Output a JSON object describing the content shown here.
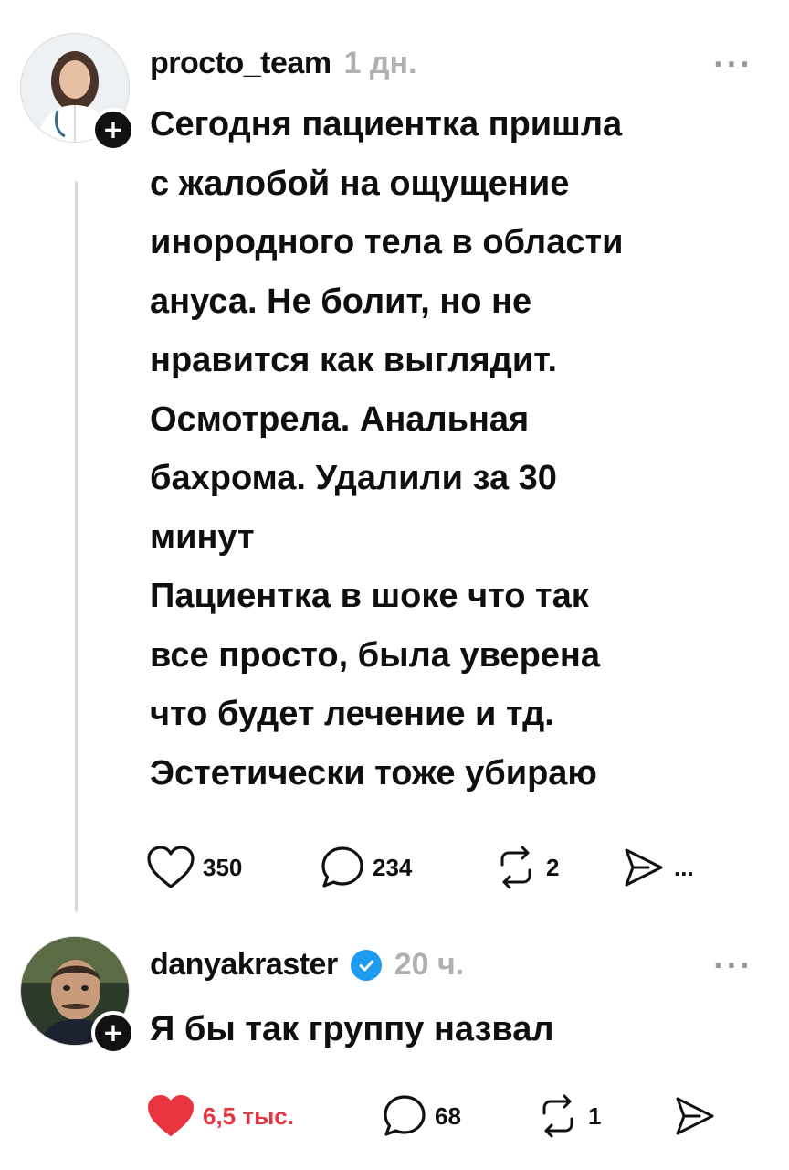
{
  "post1": {
    "username": "procto_team",
    "time": "1 дн.",
    "more": "...",
    "text": "Сегодня пациентка пришла\nс жалобой на ощущение\nинородного тела в области\nануса. Не болит, но не\nнравится как выглядит.\nОсмотрела. Анальная\nбахрома. Удалили за 30\nминут\nПациентка в шоке что так\nвсе просто, была уверена\nчто будет лечение и тд.\nЭстетически тоже убираю",
    "likes": "350",
    "comments": "234",
    "reposts": "2",
    "share_more": "..."
  },
  "post2": {
    "username": "danyakraster",
    "time": "20 ч.",
    "more": "...",
    "text": "Я бы так группу назвал",
    "likes": "6,5 тыс.",
    "comments": "68",
    "reposts": "1"
  },
  "colors": {
    "like_active": "#e8343f",
    "verified": "#1d9bf0",
    "muted": "#b0b0b0"
  },
  "icons": [
    "heart-icon",
    "comment-icon",
    "repost-icon",
    "share-icon",
    "verified-icon",
    "plus-icon",
    "more-icon"
  ]
}
